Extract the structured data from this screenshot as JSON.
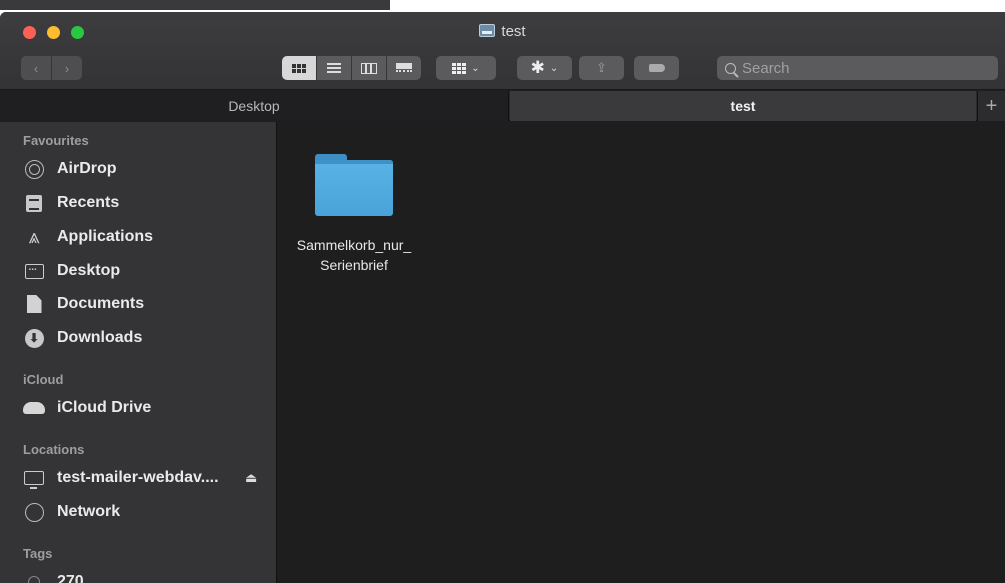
{
  "window": {
    "title": "test"
  },
  "toolbar": {
    "back_icon": "chevron-left-icon",
    "forward_icon": "chevron-right-icon",
    "view_modes": [
      "icon-view",
      "list-view",
      "column-view",
      "gallery-view"
    ],
    "active_view": "icon-view",
    "search_placeholder": "Search"
  },
  "tabs": [
    {
      "label": "Desktop",
      "active": false
    },
    {
      "label": "test",
      "active": true
    }
  ],
  "tab_add": "+",
  "sidebar": {
    "favourites_label": "Favourites",
    "favourites": [
      {
        "label": "AirDrop",
        "icon": "airdrop-icon"
      },
      {
        "label": "Recents",
        "icon": "recents-icon"
      },
      {
        "label": "Applications",
        "icon": "applications-icon"
      },
      {
        "label": "Desktop",
        "icon": "desktop-icon"
      },
      {
        "label": "Documents",
        "icon": "documents-icon"
      },
      {
        "label": "Downloads",
        "icon": "downloads-icon"
      }
    ],
    "icloud_label": "iCloud",
    "icloud": [
      {
        "label": "iCloud Drive",
        "icon": "cloud-icon"
      }
    ],
    "locations_label": "Locations",
    "locations": [
      {
        "label": "test-mailer-webdav....",
        "icon": "monitor-icon",
        "eject": "⏏"
      },
      {
        "label": "Network",
        "icon": "network-icon"
      }
    ],
    "tags_label": "Tags",
    "tags": [
      {
        "label": "270",
        "icon": "tag-circle-icon"
      }
    ]
  },
  "files": [
    {
      "name_line1": "Sammelkorb_nur_",
      "name_line2": "Serienbrief",
      "icon": "folder-icon"
    }
  ],
  "colors": {
    "folder": "#4fa8dd",
    "sidebar": "#343436",
    "content": "#1e1e1e"
  }
}
